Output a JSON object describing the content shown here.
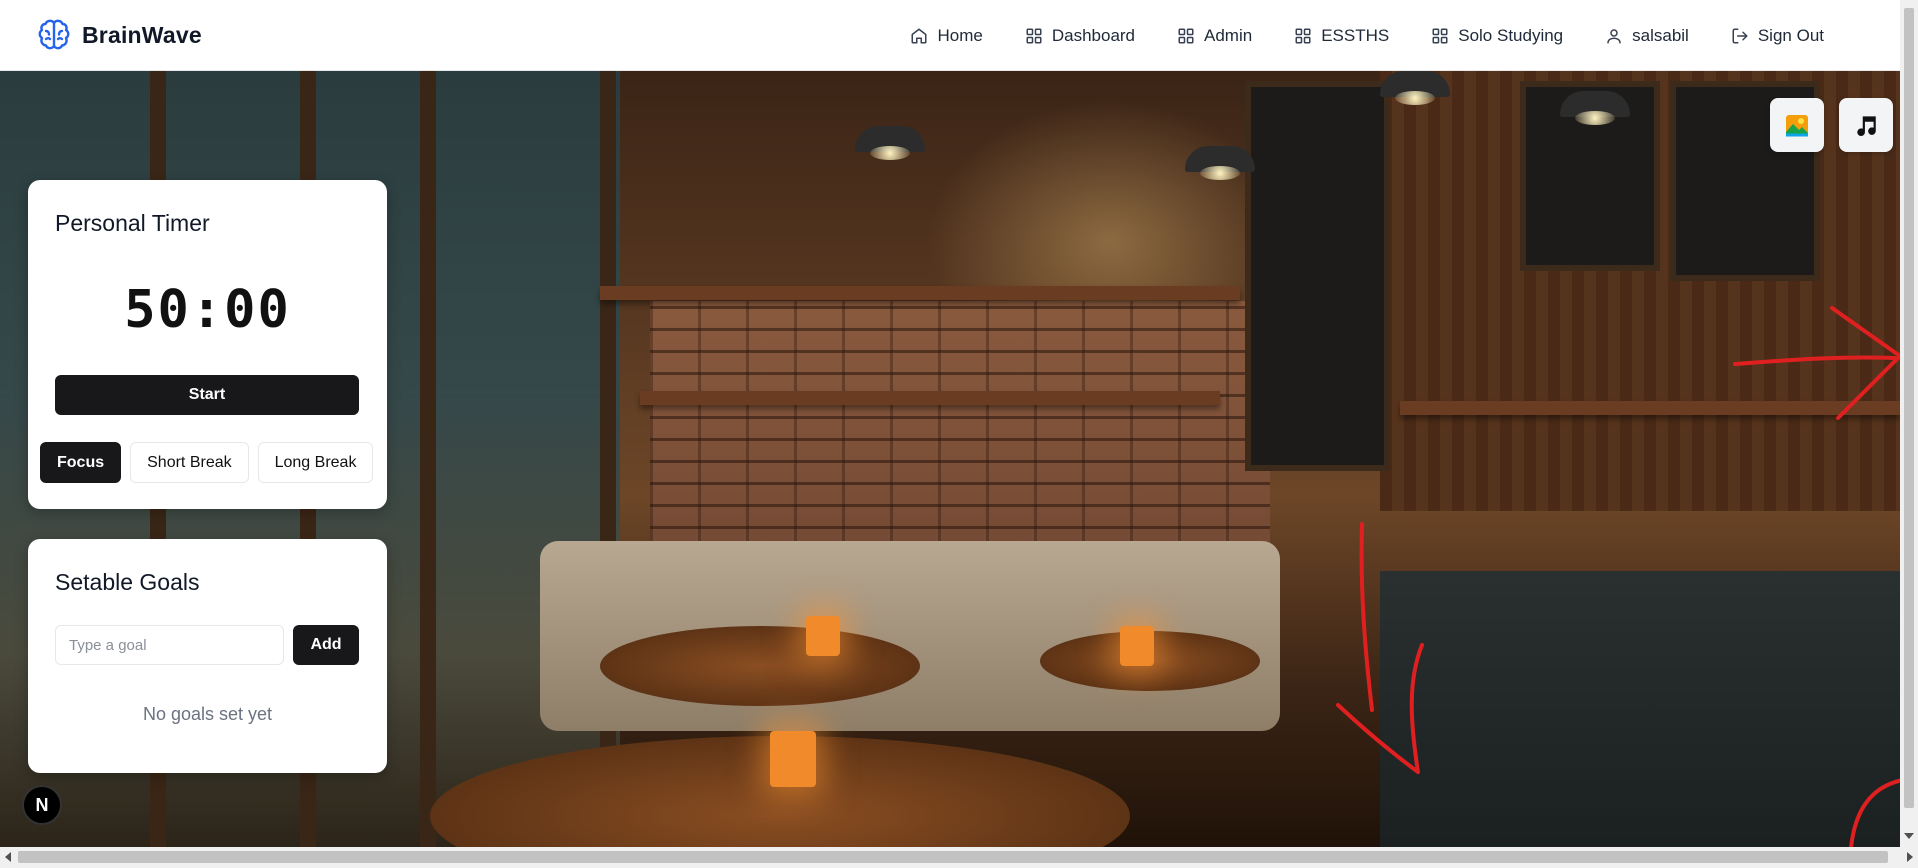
{
  "brand": {
    "name": "BrainWave",
    "accent": "#2563eb"
  },
  "nav": {
    "items": [
      {
        "label": "Home",
        "icon": "home-icon"
      },
      {
        "label": "Dashboard",
        "icon": "grid-icon"
      },
      {
        "label": "Admin",
        "icon": "grid-icon"
      },
      {
        "label": "ESSTHS",
        "icon": "grid-icon"
      },
      {
        "label": "Solo Studying",
        "icon": "grid-icon"
      },
      {
        "label": "salsabil",
        "icon": "user-icon"
      },
      {
        "label": "Sign Out",
        "icon": "sign-out-icon"
      }
    ]
  },
  "timer": {
    "title": "Personal Timer",
    "display": "50:00",
    "start_label": "Start",
    "modes": [
      "Focus",
      "Short Break",
      "Long Break"
    ],
    "active_mode": "Focus"
  },
  "goals": {
    "title": "Setable Goals",
    "input_placeholder": "Type a goal",
    "add_label": "Add",
    "empty_text": "No goals set yet"
  },
  "corner_buttons": [
    {
      "icon": "image-icon"
    },
    {
      "icon": "music-icon"
    }
  ],
  "badge": {
    "letter": "N"
  },
  "colors": {
    "button_dark": "#18181b",
    "scribble": "#e02020"
  }
}
